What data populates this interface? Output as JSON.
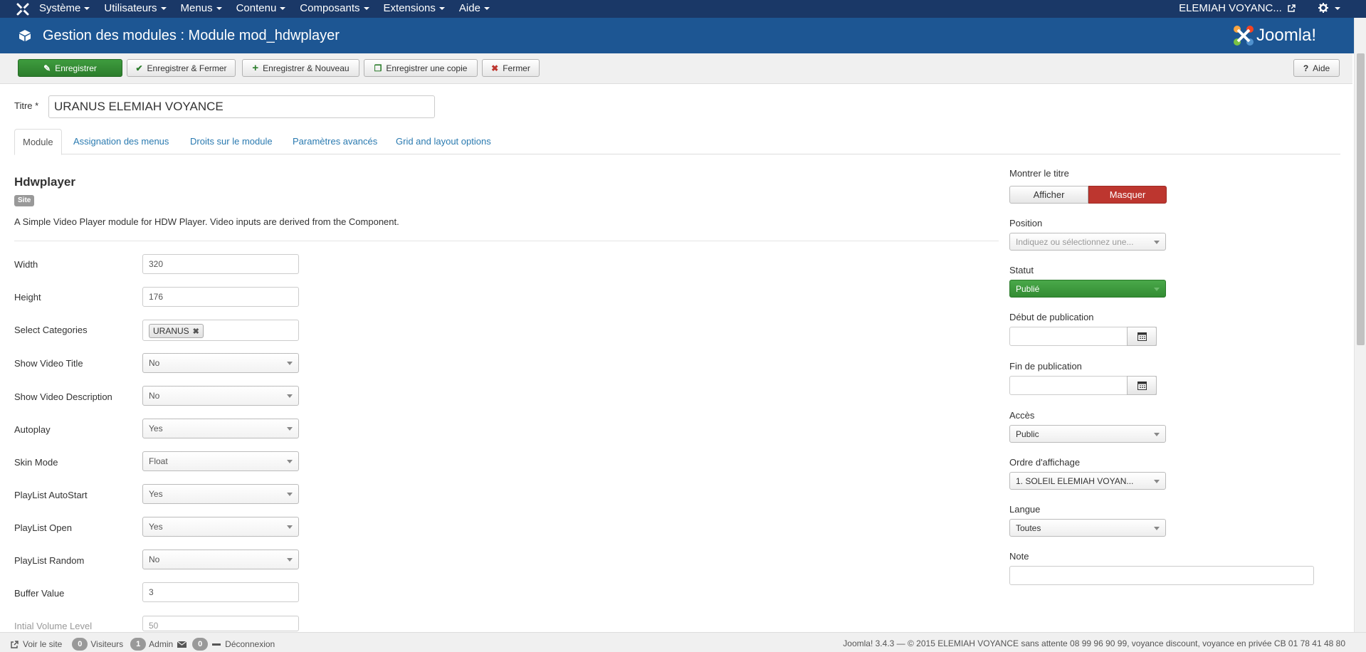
{
  "navbar": {
    "menu": [
      "Système",
      "Utilisateurs",
      "Menus",
      "Contenu",
      "Composants",
      "Extensions",
      "Aide"
    ],
    "user": "ELEMIAH VOYANC..."
  },
  "header": {
    "title": "Gestion des modules : Module mod_hdwplayer",
    "brand": "Joomla!"
  },
  "toolbar": {
    "save": "Enregistrer",
    "save_close": "Enregistrer & Fermer",
    "save_new": "Enregistrer & Nouveau",
    "save_copy": "Enregistrer une copie",
    "close": "Fermer",
    "help": "Aide"
  },
  "form": {
    "title_label": "Titre *",
    "title_value": "URANUS ELEMIAH VOYANCE",
    "tabs": [
      "Module",
      "Assignation des menus",
      "Droits sur le module",
      "Paramètres avancés",
      "Grid and layout options"
    ],
    "module_name": "Hdwplayer",
    "badge": "Site",
    "description": "A Simple Video Player module for HDW Player. Video inputs are derived from the Component.",
    "fields": {
      "width": {
        "label": "Width",
        "value": "320"
      },
      "height": {
        "label": "Height",
        "value": "176"
      },
      "categories": {
        "label": "Select Categories",
        "value": "URANUS"
      },
      "show_title": {
        "label": "Show Video Title",
        "value": "No"
      },
      "show_desc": {
        "label": "Show Video Description",
        "value": "No"
      },
      "autoplay": {
        "label": "Autoplay",
        "value": "Yes"
      },
      "skin": {
        "label": "Skin Mode",
        "value": "Float"
      },
      "pl_autostart": {
        "label": "PlayList AutoStart",
        "value": "Yes"
      },
      "pl_open": {
        "label": "PlayList Open",
        "value": "Yes"
      },
      "pl_random": {
        "label": "PlayList Random",
        "value": "No"
      },
      "buffer": {
        "label": "Buffer Value",
        "value": "3"
      },
      "volume": {
        "label": "Intial Volume Level",
        "value": "50"
      }
    }
  },
  "sidebar": {
    "show_title_label": "Montrer le titre",
    "show_title_off": "Afficher",
    "show_title_on": "Masquer",
    "position_label": "Position",
    "position_placeholder": "Indiquez ou sélectionnez une...",
    "status_label": "Statut",
    "status_value": "Publié",
    "publish_up_label": "Début de publication",
    "publish_down_label": "Fin de publication",
    "access_label": "Accès",
    "access_value": "Public",
    "ordering_label": "Ordre d'affichage",
    "ordering_value": "1. SOLEIL ELEMIAH VOYAN...",
    "language_label": "Langue",
    "language_value": "Toutes",
    "note_label": "Note"
  },
  "footer": {
    "view_site": "Voir le site",
    "visitors_count": "0",
    "visitors_label": "Visiteurs",
    "admin_count": "1",
    "admin_label": "Admin",
    "messages_count": "0",
    "logout": "Déconnexion",
    "copyright": "Joomla! 3.4.3 — © 2015 ELEMIAH VOYANCE sans attente 08 99 96 90 99, voyance discount, voyance en privée CB 01 78 41 48 80"
  },
  "colors": {
    "navbar": "#1a3867",
    "header": "#1d5693",
    "success": "#3e9c3e",
    "danger": "#bd362f",
    "link": "#2a7ab0"
  }
}
